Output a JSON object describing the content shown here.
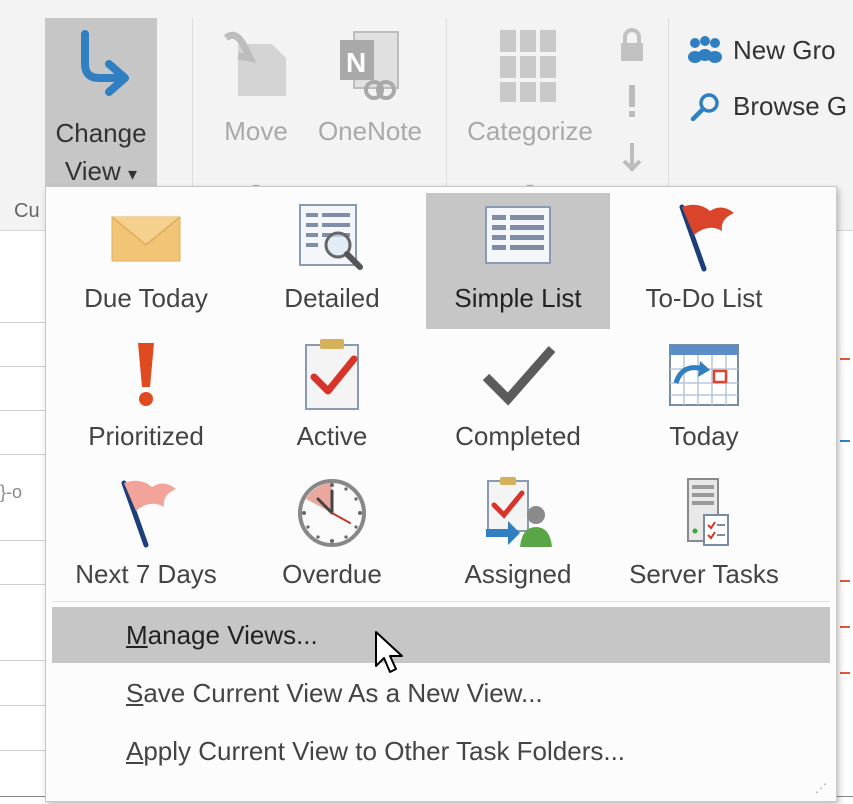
{
  "ribbon": {
    "change_view": {
      "line1": "Change",
      "line2": "View",
      "dropdown_arrow": "▾"
    },
    "move": "Move",
    "onenote": "OneNote",
    "categorize": "Categorize",
    "new_group": "New Gro",
    "browse": "Browse G",
    "group_label_fragment": "Cu"
  },
  "gallery": {
    "items": [
      {
        "label": "Due Today",
        "icon": "envelope-icon"
      },
      {
        "label": "Detailed",
        "icon": "detailed-view-icon"
      },
      {
        "label": "Simple List",
        "icon": "simple-list-icon",
        "selected": true
      },
      {
        "label": "To-Do List",
        "icon": "red-flag-icon"
      },
      {
        "label": "Prioritized",
        "icon": "exclamation-icon"
      },
      {
        "label": "Active",
        "icon": "clipboard-check-icon"
      },
      {
        "label": "Completed",
        "icon": "checkmark-icon"
      },
      {
        "label": "Today",
        "icon": "calendar-arrow-icon"
      },
      {
        "label": "Next 7 Days",
        "icon": "pink-flag-icon"
      },
      {
        "label": "Overdue",
        "icon": "clock-icon"
      },
      {
        "label": "Assigned",
        "icon": "assigned-user-icon"
      },
      {
        "label": "Server Tasks",
        "icon": "server-tasks-icon"
      }
    ]
  },
  "menu": {
    "manage_views": {
      "accel": "M",
      "rest": "anage Views..."
    },
    "save_view": {
      "accel": "S",
      "rest": "ave Current View As a New View..."
    },
    "apply_view": {
      "accel": "A",
      "rest": "pply Current View to Other Task Folders..."
    }
  },
  "background": {
    "fragment": "}-o"
  },
  "colors": {
    "selected_bg": "#c6c6c6",
    "hover_bg": "#c6c6c6",
    "accent_blue": "#2f7fc1",
    "flag_red": "#d9442b"
  }
}
